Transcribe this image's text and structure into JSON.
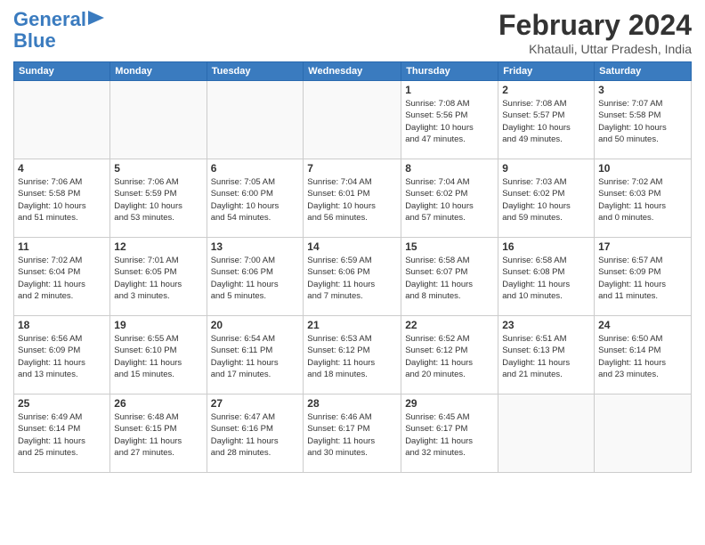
{
  "logo": {
    "line1": "General",
    "line2": "Blue"
  },
  "title": "February 2024",
  "location": "Khatauli, Uttar Pradesh, India",
  "days_header": [
    "Sunday",
    "Monday",
    "Tuesday",
    "Wednesday",
    "Thursday",
    "Friday",
    "Saturday"
  ],
  "weeks": [
    [
      {
        "day": "",
        "info": ""
      },
      {
        "day": "",
        "info": ""
      },
      {
        "day": "",
        "info": ""
      },
      {
        "day": "",
        "info": ""
      },
      {
        "day": "1",
        "info": "Sunrise: 7:08 AM\nSunset: 5:56 PM\nDaylight: 10 hours\nand 47 minutes."
      },
      {
        "day": "2",
        "info": "Sunrise: 7:08 AM\nSunset: 5:57 PM\nDaylight: 10 hours\nand 49 minutes."
      },
      {
        "day": "3",
        "info": "Sunrise: 7:07 AM\nSunset: 5:58 PM\nDaylight: 10 hours\nand 50 minutes."
      }
    ],
    [
      {
        "day": "4",
        "info": "Sunrise: 7:06 AM\nSunset: 5:58 PM\nDaylight: 10 hours\nand 51 minutes."
      },
      {
        "day": "5",
        "info": "Sunrise: 7:06 AM\nSunset: 5:59 PM\nDaylight: 10 hours\nand 53 minutes."
      },
      {
        "day": "6",
        "info": "Sunrise: 7:05 AM\nSunset: 6:00 PM\nDaylight: 10 hours\nand 54 minutes."
      },
      {
        "day": "7",
        "info": "Sunrise: 7:04 AM\nSunset: 6:01 PM\nDaylight: 10 hours\nand 56 minutes."
      },
      {
        "day": "8",
        "info": "Sunrise: 7:04 AM\nSunset: 6:02 PM\nDaylight: 10 hours\nand 57 minutes."
      },
      {
        "day": "9",
        "info": "Sunrise: 7:03 AM\nSunset: 6:02 PM\nDaylight: 10 hours\nand 59 minutes."
      },
      {
        "day": "10",
        "info": "Sunrise: 7:02 AM\nSunset: 6:03 PM\nDaylight: 11 hours\nand 0 minutes."
      }
    ],
    [
      {
        "day": "11",
        "info": "Sunrise: 7:02 AM\nSunset: 6:04 PM\nDaylight: 11 hours\nand 2 minutes."
      },
      {
        "day": "12",
        "info": "Sunrise: 7:01 AM\nSunset: 6:05 PM\nDaylight: 11 hours\nand 3 minutes."
      },
      {
        "day": "13",
        "info": "Sunrise: 7:00 AM\nSunset: 6:06 PM\nDaylight: 11 hours\nand 5 minutes."
      },
      {
        "day": "14",
        "info": "Sunrise: 6:59 AM\nSunset: 6:06 PM\nDaylight: 11 hours\nand 7 minutes."
      },
      {
        "day": "15",
        "info": "Sunrise: 6:58 AM\nSunset: 6:07 PM\nDaylight: 11 hours\nand 8 minutes."
      },
      {
        "day": "16",
        "info": "Sunrise: 6:58 AM\nSunset: 6:08 PM\nDaylight: 11 hours\nand 10 minutes."
      },
      {
        "day": "17",
        "info": "Sunrise: 6:57 AM\nSunset: 6:09 PM\nDaylight: 11 hours\nand 11 minutes."
      }
    ],
    [
      {
        "day": "18",
        "info": "Sunrise: 6:56 AM\nSunset: 6:09 PM\nDaylight: 11 hours\nand 13 minutes."
      },
      {
        "day": "19",
        "info": "Sunrise: 6:55 AM\nSunset: 6:10 PM\nDaylight: 11 hours\nand 15 minutes."
      },
      {
        "day": "20",
        "info": "Sunrise: 6:54 AM\nSunset: 6:11 PM\nDaylight: 11 hours\nand 17 minutes."
      },
      {
        "day": "21",
        "info": "Sunrise: 6:53 AM\nSunset: 6:12 PM\nDaylight: 11 hours\nand 18 minutes."
      },
      {
        "day": "22",
        "info": "Sunrise: 6:52 AM\nSunset: 6:12 PM\nDaylight: 11 hours\nand 20 minutes."
      },
      {
        "day": "23",
        "info": "Sunrise: 6:51 AM\nSunset: 6:13 PM\nDaylight: 11 hours\nand 21 minutes."
      },
      {
        "day": "24",
        "info": "Sunrise: 6:50 AM\nSunset: 6:14 PM\nDaylight: 11 hours\nand 23 minutes."
      }
    ],
    [
      {
        "day": "25",
        "info": "Sunrise: 6:49 AM\nSunset: 6:14 PM\nDaylight: 11 hours\nand 25 minutes."
      },
      {
        "day": "26",
        "info": "Sunrise: 6:48 AM\nSunset: 6:15 PM\nDaylight: 11 hours\nand 27 minutes."
      },
      {
        "day": "27",
        "info": "Sunrise: 6:47 AM\nSunset: 6:16 PM\nDaylight: 11 hours\nand 28 minutes."
      },
      {
        "day": "28",
        "info": "Sunrise: 6:46 AM\nSunset: 6:17 PM\nDaylight: 11 hours\nand 30 minutes."
      },
      {
        "day": "29",
        "info": "Sunrise: 6:45 AM\nSunset: 6:17 PM\nDaylight: 11 hours\nand 32 minutes."
      },
      {
        "day": "",
        "info": ""
      },
      {
        "day": "",
        "info": ""
      }
    ]
  ]
}
